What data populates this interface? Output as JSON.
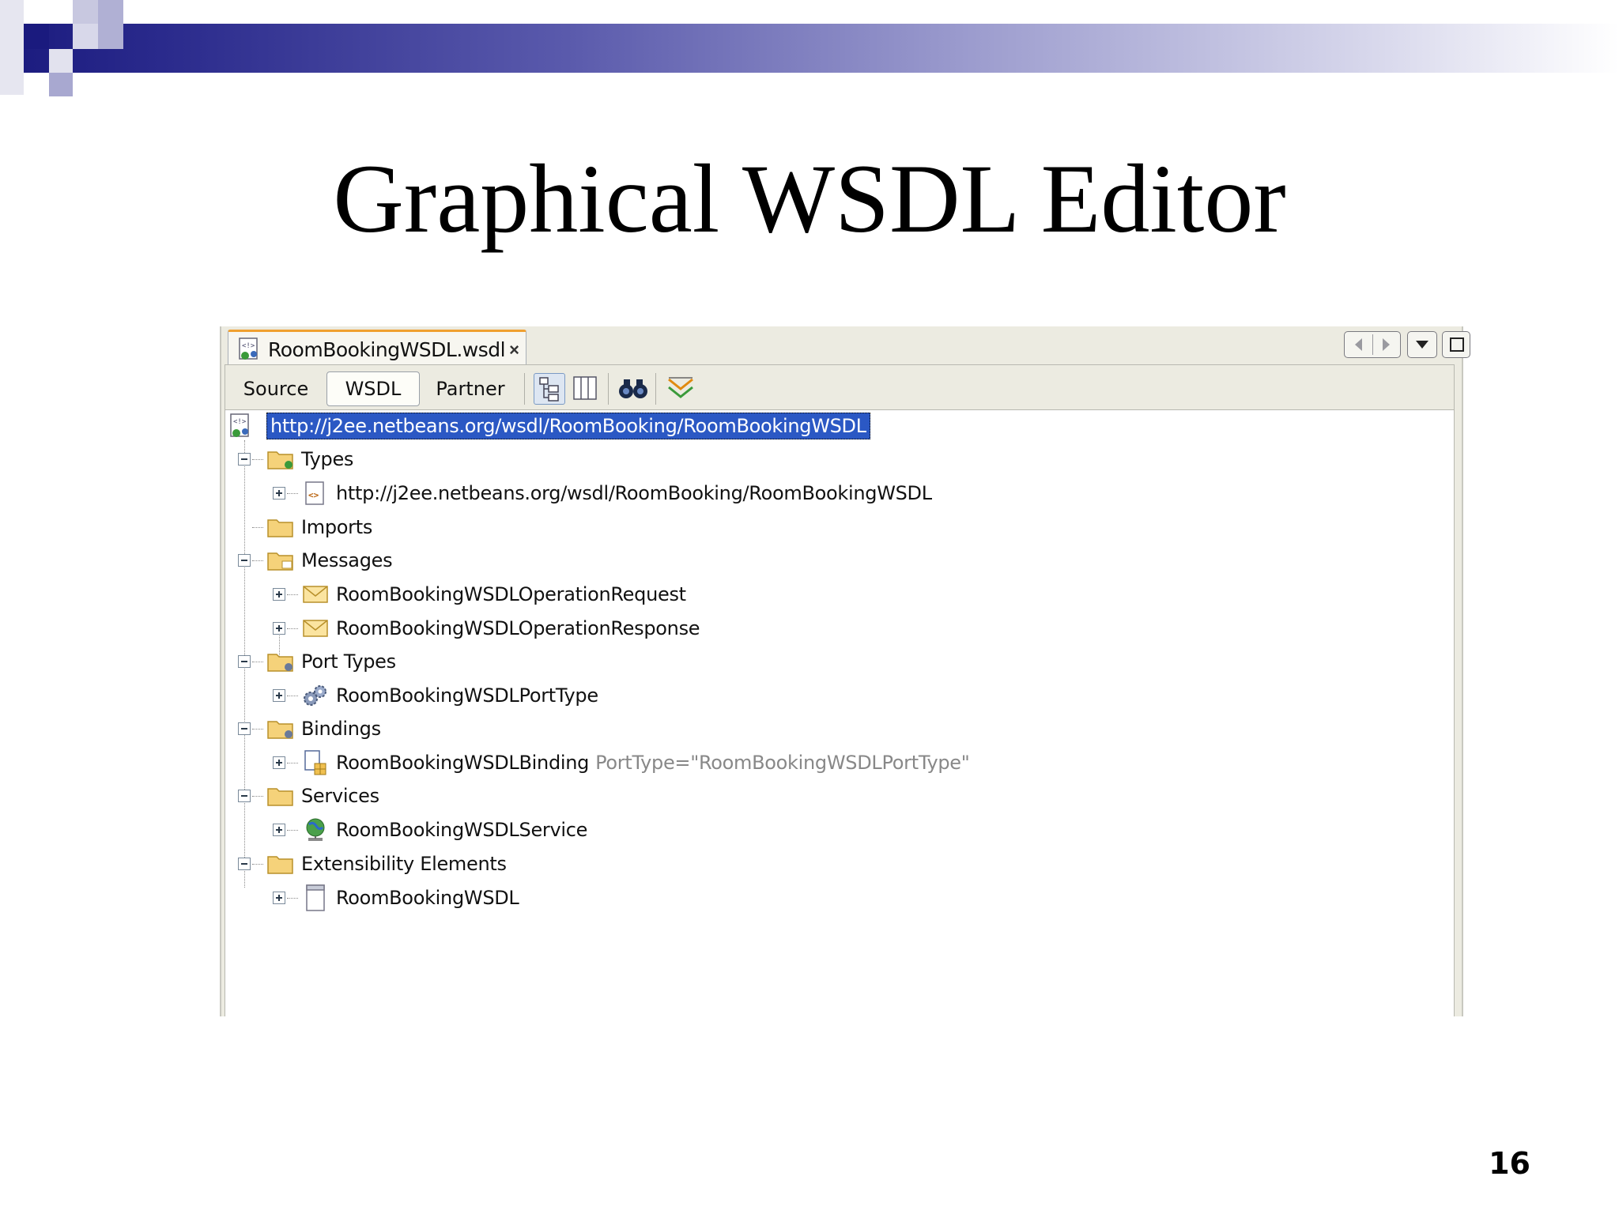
{
  "slide": {
    "title": "Graphical WSDL Editor",
    "page_number": "16",
    "band_color": "#1a1a7e"
  },
  "editor": {
    "tab_title": "RoomBookingWSDL.wsdl",
    "tab_close": "×",
    "views": [
      "Source",
      "WSDL",
      "Partner"
    ],
    "active_view": "WSDL",
    "toolbar_icons": [
      "tree-view-icon",
      "column-view-icon",
      "find-binoculars-icon",
      "validate-xml-icon"
    ],
    "window_buttons": [
      "scroll-left-icon",
      "scroll-right-icon",
      "dropdown-icon",
      "maximize-icon"
    ]
  },
  "tree": {
    "root": "http://j2ee.netbeans.org/wsdl/RoomBooking/RoomBookingWSDL",
    "nodes": [
      {
        "label": "Types",
        "icon": "types-folder-icon",
        "children": [
          {
            "label": "http://j2ee.netbeans.org/wsdl/RoomBooking/RoomBookingWSDL",
            "icon": "schema-icon"
          }
        ]
      },
      {
        "label": "Imports",
        "icon": "folder-icon",
        "children": []
      },
      {
        "label": "Messages",
        "icon": "messages-folder-icon",
        "children": [
          {
            "label": "RoomBookingWSDLOperationRequest",
            "icon": "envelope-icon"
          },
          {
            "label": "RoomBookingWSDLOperationResponse",
            "icon": "envelope-icon"
          }
        ]
      },
      {
        "label": "Port Types",
        "icon": "porttypes-folder-icon",
        "children": [
          {
            "label": "RoomBookingWSDLPortType",
            "icon": "gears-icon"
          }
        ]
      },
      {
        "label": "Bindings",
        "icon": "bindings-folder-icon",
        "children": [
          {
            "label": "RoomBookingWSDLBinding",
            "attr": "PortType=\"RoomBookingWSDLPortType\"",
            "icon": "binding-icon"
          }
        ]
      },
      {
        "label": "Services",
        "icon": "folder-icon",
        "children": [
          {
            "label": "RoomBookingWSDLService",
            "icon": "globe-icon"
          }
        ]
      },
      {
        "label": "Extensibility Elements",
        "icon": "folder-icon",
        "children": [
          {
            "label": "RoomBookingWSDL",
            "icon": "document-icon"
          }
        ]
      }
    ]
  }
}
